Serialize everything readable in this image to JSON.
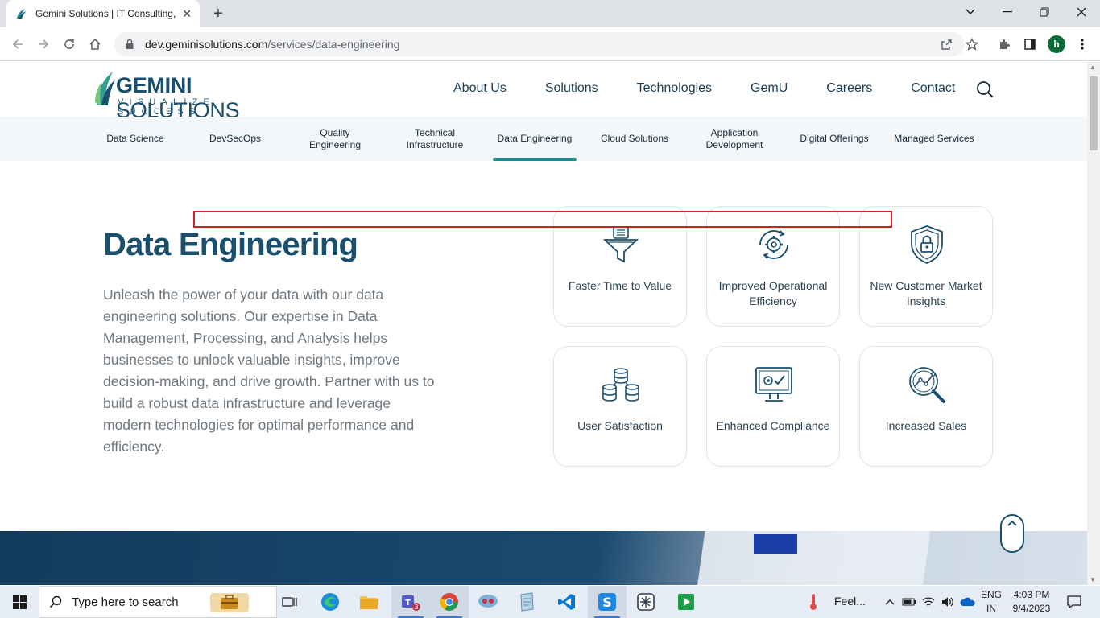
{
  "browser": {
    "tab_title": "Gemini Solutions | IT Consulting,",
    "tab_close": "✕",
    "new_tab": "+",
    "url_host": "dev.geminisolutions.com",
    "url_path": "/services/data-engineering",
    "profile_initial": "h"
  },
  "header": {
    "logo_word_bold": "GEMINI",
    "logo_word_light": " SOLUTIONS",
    "logo_tagline": "VISUALIZE SUCCESS",
    "nav": [
      "About Us",
      "Solutions",
      "Technologies",
      "GemU",
      "Careers",
      "Contact"
    ]
  },
  "subnav": {
    "items": [
      {
        "label": "Data Science"
      },
      {
        "label": "DevSecOps"
      },
      {
        "label": "Quality Engineering"
      },
      {
        "label": "Technical Infrastructure"
      },
      {
        "label": "Data Engineering",
        "active": true
      },
      {
        "label": "Cloud Solutions"
      },
      {
        "label": "Application Development"
      },
      {
        "label": "Digital Offerings"
      },
      {
        "label": "Managed Services"
      }
    ]
  },
  "hero": {
    "title": "Data Engineering",
    "description": "Unleash the power of your data with our data engineering solutions. Our expertise in Data Management, Processing, and Analysis helps businesses to unlock valuable insights, improve decision-making, and drive growth. Partner with us to build a robust data infrastructure and leverage modern technologies for optimal performance and efficiency."
  },
  "benefits": [
    {
      "label": "Faster Time to Value",
      "icon": "funnel-icon"
    },
    {
      "label": "Improved Operational Efficiency",
      "icon": "gear-cycle-icon"
    },
    {
      "label": "New Customer Market Insights",
      "icon": "shield-lock-icon"
    },
    {
      "label": "User Satisfaction",
      "icon": "database-coins-icon"
    },
    {
      "label": "Enhanced Compliance",
      "icon": "monitor-check-icon"
    },
    {
      "label": "Increased Sales",
      "icon": "magnifier-chart-icon"
    }
  ],
  "taskbar": {
    "search_placeholder": "Type here to search",
    "weather": "Feel...",
    "lang_1": "ENG",
    "lang_2": "IN",
    "time": "4:03 PM",
    "date": "9/4/2023"
  },
  "colors": {
    "brand_navy": "#1b4f6e",
    "accent_teal": "#1e8a8a",
    "highlight_red": "#d61f1f"
  }
}
